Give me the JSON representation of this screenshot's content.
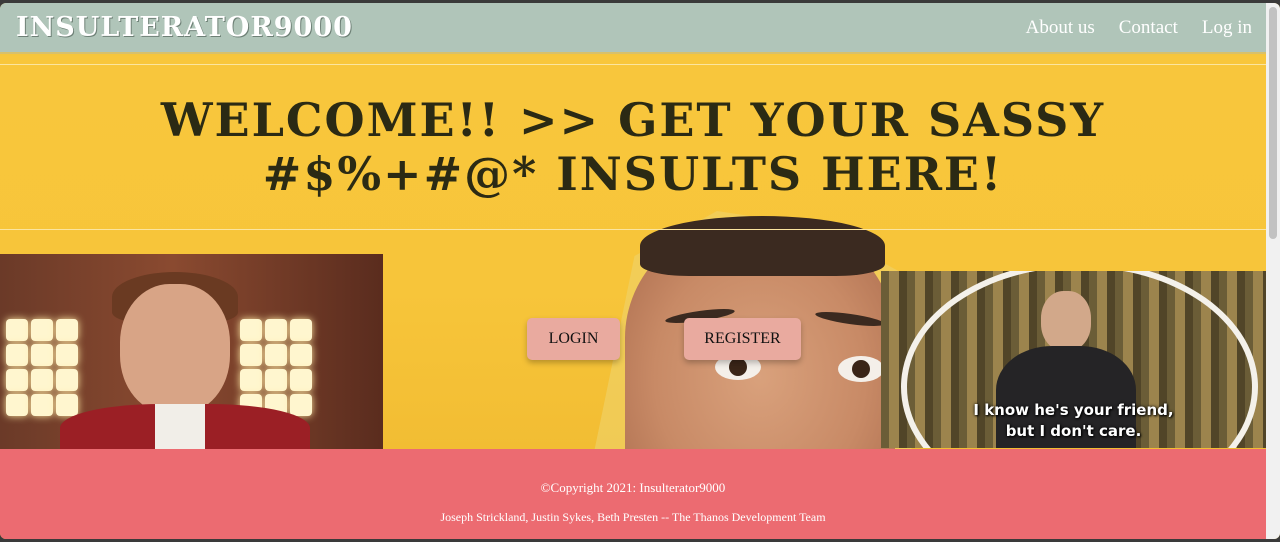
{
  "navbar": {
    "brand": "INSULTERATOR9000",
    "links": [
      "About us",
      "Contact",
      "Log in"
    ]
  },
  "hero": {
    "headline": "WELCOME!! >> GET YOUR SASSY #$%+#@* INSULTS HERE!",
    "login_label": "LOGIN",
    "register_label": "REGISTER",
    "right_image_caption_line1": "I know he's your friend,",
    "right_image_caption_line2": "but I don't care."
  },
  "footer": {
    "copyright": "©Copyright 2021: Insulterator9000",
    "team": "Joseph Strickland, Justin Sykes, Beth Presten -- The Thanos Development Team"
  },
  "colors": {
    "navbar_bg": "#b0c5b9",
    "hero_bg": "#f6c63c",
    "button_bg": "#e9aa9f",
    "footer_bg": "#ec6b71"
  }
}
